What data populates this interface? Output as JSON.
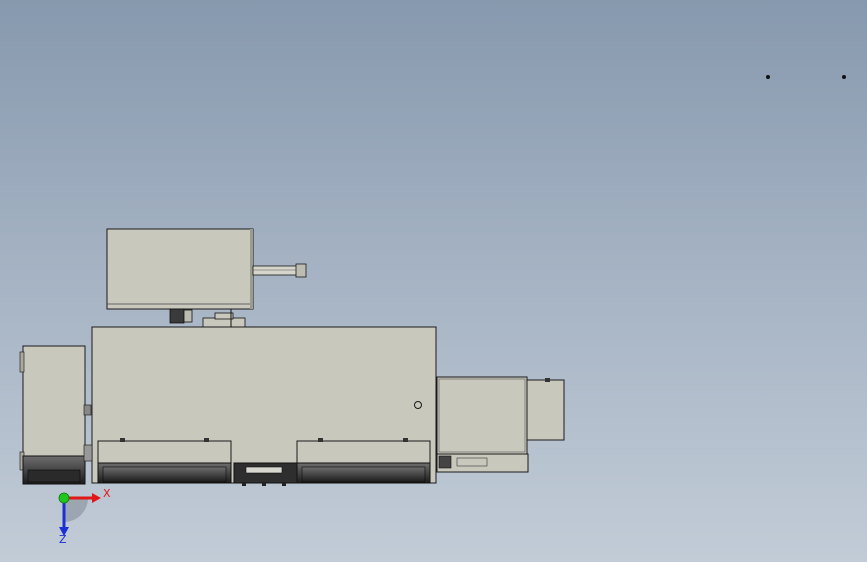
{
  "viewport": {
    "background_top": "#8799ae",
    "background_bottom": "#c2ccd7"
  },
  "model": {
    "body_color": "#c9c8bd",
    "edge_color": "#1a1a1a",
    "base_dark": "#2a2a2a"
  },
  "triad": {
    "x_label": "X",
    "z_label": "Z",
    "x_color": "#e01818",
    "y_color": "#1ec81e",
    "z_color": "#1c2fd6"
  }
}
